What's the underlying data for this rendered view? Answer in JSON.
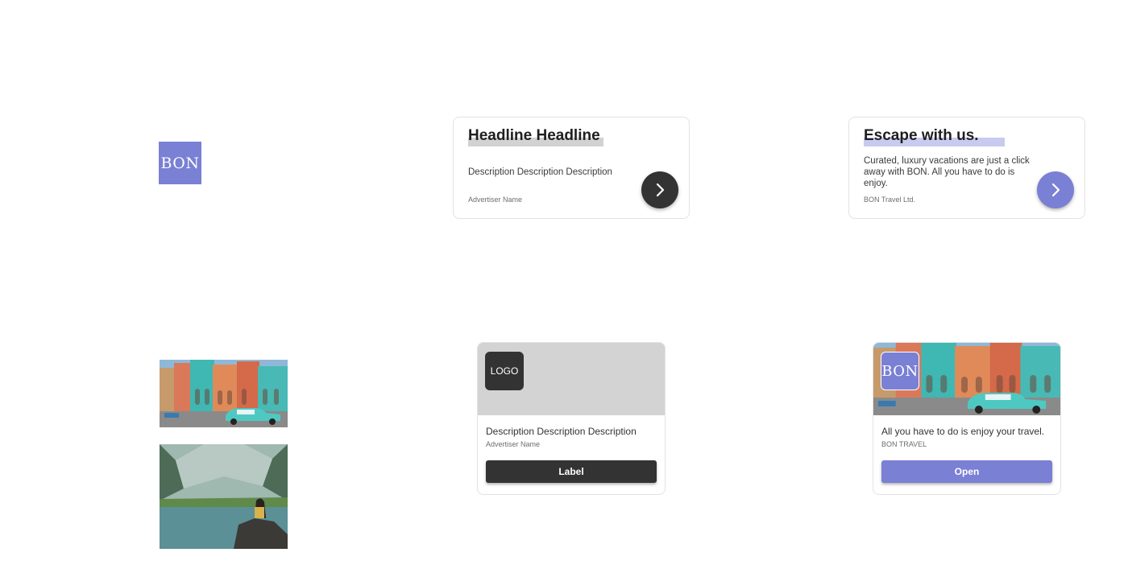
{
  "brand": {
    "logo_text": "BON",
    "accent_color": "#7a80d4",
    "template_color": "#333333"
  },
  "assets": {
    "photos": [
      {
        "name": "havana-street-photo"
      },
      {
        "name": "mountain-lake-photo"
      }
    ]
  },
  "banner_template": {
    "headline": "Headline Headline",
    "description": "Description Description Description",
    "advertiser": "Advertiser Name",
    "button_icon": "chevron-right-icon"
  },
  "banner_filled": {
    "headline": "Escape with us.",
    "description": "Curated, luxury vacations are just a click away with BON. All you have to do is enjoy.",
    "advertiser": "BON Travel Ltd.",
    "button_icon": "chevron-right-icon"
  },
  "vertical_template": {
    "logo": "LOGO",
    "description": "Description Description Description",
    "advertiser": "Advertiser Name",
    "cta": "Label"
  },
  "vertical_filled": {
    "logo": "BON",
    "description": "All you have to do is enjoy your travel.",
    "advertiser": "BON TRAVEL",
    "cta": "Open"
  }
}
